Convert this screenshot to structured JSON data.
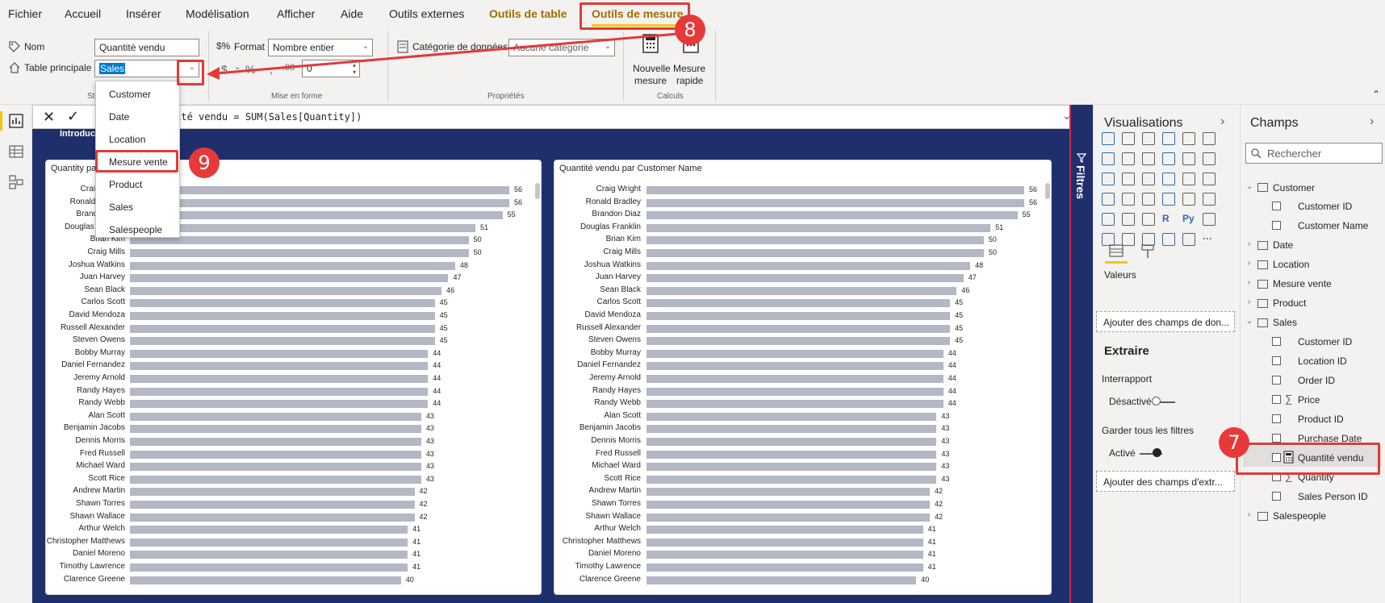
{
  "menu": {
    "items": [
      "Fichier",
      "Accueil",
      "Insérer",
      "Modélisation",
      "Afficher",
      "Aide",
      "Outils externes",
      "Outils de table",
      "Outils de mesure"
    ],
    "active": "Outils de mesure"
  },
  "ribbon": {
    "nom_label": "Nom",
    "nom_value": "Quantité vendu",
    "table_label": "Table principale",
    "table_value": "Sales",
    "structure_group": "St",
    "format_label": "Format",
    "format_value": "Nombre entier",
    "currency_symbol": "$",
    "percent_symbol": "%",
    "comma_symbol": ",",
    "decimal_value": "0",
    "mise_en_forme_group": "Mise en forme",
    "categorie_label": "Catégorie de données",
    "categorie_value": "Aucune catégorie",
    "proprietes_group": "Propriétés",
    "nouvelle_mesure_line1": "Nouvelle",
    "nouvelle_mesure_line2": "mesure",
    "mesure_rapide_line1": "Mesure",
    "mesure_rapide_line2": "rapide",
    "calculs_group": "Calculs"
  },
  "formula": {
    "text": "Quantité vendu = SUM(Sales[Quantity])"
  },
  "canvas": {
    "page_title_fragment": "Introduc"
  },
  "dropdown": {
    "items": [
      "Customer",
      "Date",
      "Location",
      "Mesure vente",
      "Product",
      "Sales",
      "Salespeople"
    ],
    "highlighted": "Mesure vente"
  },
  "chart_data": [
    {
      "type": "bar",
      "orientation": "horizontal",
      "title": "Quantity pa",
      "categories": [
        "Craig Wright",
        "Ronald Bradley",
        "Brandon Diaz",
        "Douglas Franklin",
        "Brian Kim",
        "Craig Mills",
        "Joshua Watkins",
        "Juan Harvey",
        "Sean Black",
        "Carlos Scott",
        "David Mendoza",
        "Russell Alexander",
        "Steven Owens",
        "Bobby Murray",
        "Daniel Fernandez",
        "Jeremy Arnold",
        "Randy Hayes",
        "Randy Webb",
        "Alan Scott",
        "Benjamin Jacobs",
        "Dennis Morris",
        "Fred Russell",
        "Michael Ward",
        "Scott Rice",
        "Andrew Martin",
        "Shawn Torres",
        "Shawn Wallace",
        "Arthur Welch",
        "Christopher Matthews",
        "Daniel Moreno",
        "Timothy Lawrence",
        "Clarence Greene"
      ],
      "values": [
        56,
        56,
        55,
        51,
        50,
        50,
        48,
        47,
        46,
        45,
        45,
        45,
        45,
        44,
        44,
        44,
        44,
        44,
        43,
        43,
        43,
        43,
        43,
        43,
        42,
        42,
        42,
        41,
        41,
        41,
        41,
        40
      ]
    },
    {
      "type": "bar",
      "orientation": "horizontal",
      "title": "Quantité vendu par Customer Name",
      "categories": [
        "Craig Wright",
        "Ronald Bradley",
        "Brandon Diaz",
        "Douglas Franklin",
        "Brian Kim",
        "Craig Mills",
        "Joshua Watkins",
        "Juan Harvey",
        "Sean Black",
        "Carlos Scott",
        "David Mendoza",
        "Russell Alexander",
        "Steven Owens",
        "Bobby Murray",
        "Daniel Fernandez",
        "Jeremy Arnold",
        "Randy Hayes",
        "Randy Webb",
        "Alan Scott",
        "Benjamin Jacobs",
        "Dennis Morris",
        "Fred Russell",
        "Michael Ward",
        "Scott Rice",
        "Andrew Martin",
        "Shawn Torres",
        "Shawn Wallace",
        "Arthur Welch",
        "Christopher Matthews",
        "Daniel Moreno",
        "Timothy Lawrence",
        "Clarence Greene"
      ],
      "values": [
        56,
        56,
        55,
        51,
        50,
        50,
        48,
        47,
        46,
        45,
        45,
        45,
        45,
        44,
        44,
        44,
        44,
        44,
        43,
        43,
        43,
        43,
        43,
        43,
        42,
        42,
        42,
        41,
        41,
        41,
        41,
        40
      ]
    }
  ],
  "filters": {
    "label": "Filtres"
  },
  "visualisations": {
    "title": "Visualisations",
    "valeurs_label": "Valeurs",
    "add_values_placeholder": "Ajouter des champs de don...",
    "extraire_title": "Extraire",
    "interrapport_label": "Interrapport",
    "interrapport_state": "Désactivé",
    "garder_label": "Garder tous les filtres",
    "garder_state": "Activé",
    "add_drill_placeholder": "Ajouter des champs d'extr..."
  },
  "fields": {
    "title": "Champs",
    "search_placeholder": "Rechercher",
    "tables": {
      "customer": "Customer",
      "customer_fields": [
        "Customer ID",
        "Customer Name"
      ],
      "date": "Date",
      "location": "Location",
      "mesure_vente": "Mesure vente",
      "product": "Product",
      "sales": "Sales",
      "sales_fields": [
        "Customer ID",
        "Location ID",
        "Order ID",
        "Price",
        "Product ID",
        "Purchase Date",
        "Quantité vendu",
        "Quantity",
        "Sales Person ID"
      ],
      "salespeople": "Salespeople"
    }
  },
  "annotations": {
    "step7": "7",
    "step8": "8",
    "step9": "9"
  },
  "colors": {
    "accent": "#f2c811",
    "canvas_bg": "#1f2f6b",
    "bar": "#b3b8c4",
    "annotation": "#e03a3a",
    "context_tab": "#a26c00"
  }
}
